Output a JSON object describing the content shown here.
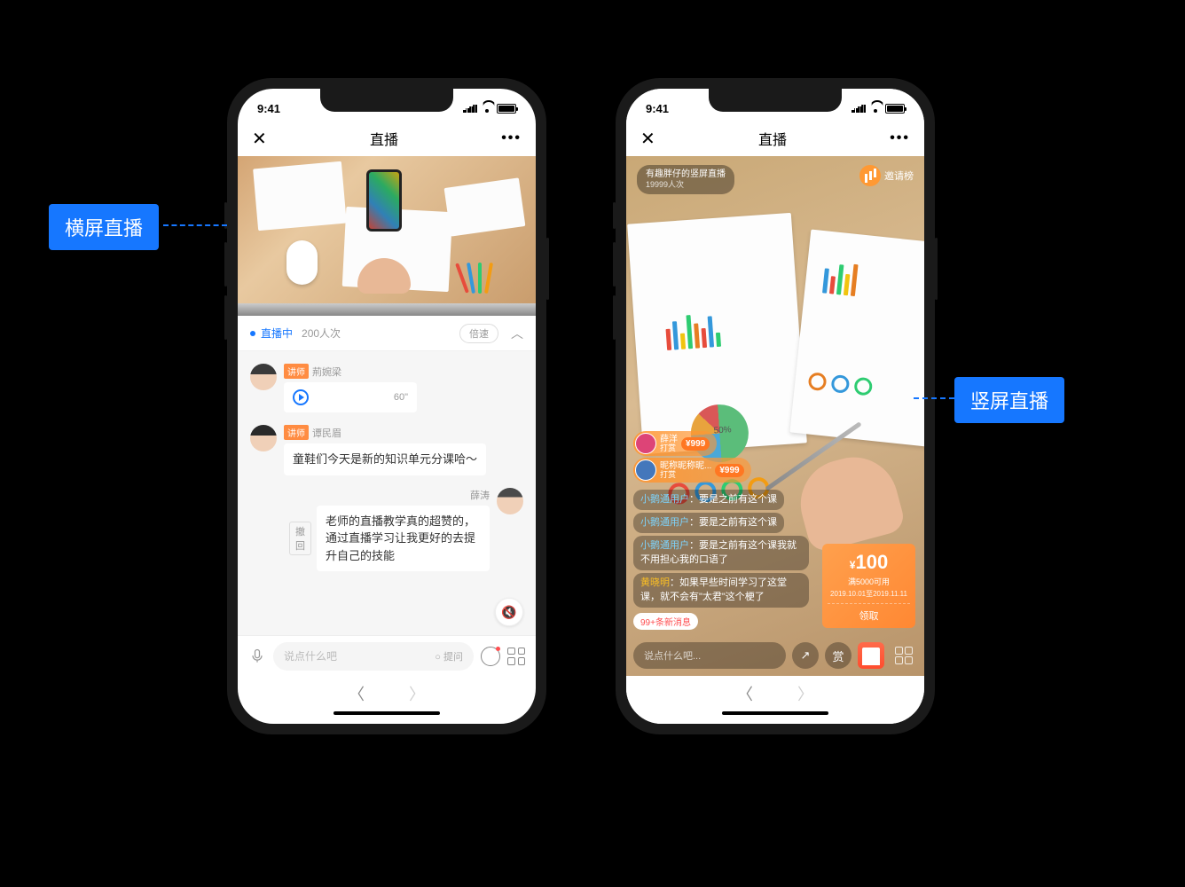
{
  "labels": {
    "landscape": "横屏直播",
    "portrait": "竖屏直播"
  },
  "status": {
    "time": "9:41"
  },
  "nav": {
    "title": "直播",
    "close": "✕",
    "more": "•••"
  },
  "left": {
    "live_status": "直播中",
    "view_count": "200人次",
    "speed": "倍速",
    "collapse": "︿",
    "teacher_tag": "讲师",
    "msg1_name": "荊婉梁",
    "msg1_duration": "60\"",
    "msg2_name": "谭民眉",
    "msg2_text": "童鞋们今天是新的知识单元分课哈～",
    "msg3_name": "薛涛",
    "msg3_text": "老师的直播教学真的超赞的，通过直播学习让我更好的去提升自己的技能",
    "recall": "撤回",
    "input_placeholder": "说点什么吧",
    "ask": "○ 提问"
  },
  "right": {
    "room_title": "有趣胖仔的竖屏直播",
    "room_sub": "19999人次",
    "invite": "邀请榜",
    "gift1_name": "薛洋",
    "gift1_action": "打赏",
    "gift1_amt": "¥999",
    "gift2_name": "昵称昵称昵...",
    "gift2_action": "打赏",
    "gift2_amt": "¥999",
    "cmt1_user": "小鹅通用户",
    "cmt1_text": "：要是之前有这个课",
    "cmt2_user": "小鹅通用户",
    "cmt2_text": "：要是之前有这个课",
    "cmt3_user": "小鹅通用户",
    "cmt3_text": "：要是之前有这个课我就不用担心我的口语了",
    "cmt4_user": "黄晓明",
    "cmt4_text": "：如果早些时间学习了这堂课，就不会有\"太君\"这个梗了",
    "new_msg": "99+条新消息",
    "coupon_amt": "100",
    "coupon_cond": "满5000可用",
    "coupon_date": "2019.10.01至2019.11.11",
    "coupon_get": "领取",
    "input_placeholder": "说点什么吧...",
    "reward": "赏"
  },
  "bottom": {
    "back": "〈",
    "fwd": "〉"
  }
}
